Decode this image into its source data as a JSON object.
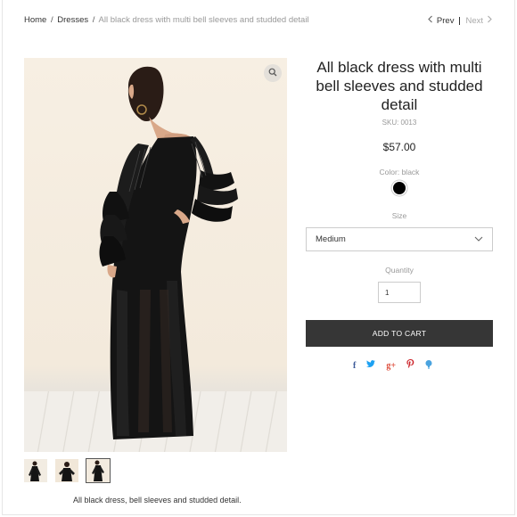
{
  "breadcrumb": {
    "home": "Home",
    "separator": "/",
    "category": "Dresses",
    "current": "All black dress with multi bell sleeves and studded detail"
  },
  "pager": {
    "prev_label": "Prev",
    "next_label": "Next",
    "prev_icon": "chevron-left-icon",
    "next_icon": "chevron-right-icon"
  },
  "gallery": {
    "main_image": "woman-in-black-maxi-dress-back-view",
    "zoom_icon": "search-icon",
    "thumbnails": [
      {
        "name": "thumbnail-front-view",
        "active": false
      },
      {
        "name": "thumbnail-side-view",
        "active": false
      },
      {
        "name": "thumbnail-back-view",
        "active": true
      }
    ]
  },
  "product": {
    "title": "All black dress with multi bell sleeves and studded detail",
    "sku": "SKU: 0013",
    "price": "$57.00",
    "color_label": "Color: black",
    "color_swatch": "#000000",
    "size_label": "Size",
    "size_value": "Medium",
    "quantity_label": "Quantity",
    "quantity_value": "1",
    "add_to_cart": "ADD TO CART",
    "description": "All black dress, bell sleeves and studded detail."
  },
  "share": [
    {
      "name": "facebook-icon",
      "glyph": "f",
      "color": "#3b5998"
    },
    {
      "name": "twitter-icon",
      "glyph": "🐦",
      "color": "#1da1f2"
    },
    {
      "name": "google-plus-icon",
      "glyph": "g+",
      "color": "#dd4b39"
    },
    {
      "name": "pinterest-icon",
      "glyph": "P",
      "color": "#cb2027"
    },
    {
      "name": "fancy-icon",
      "glyph": "●",
      "color": "#4aa3df"
    }
  ]
}
